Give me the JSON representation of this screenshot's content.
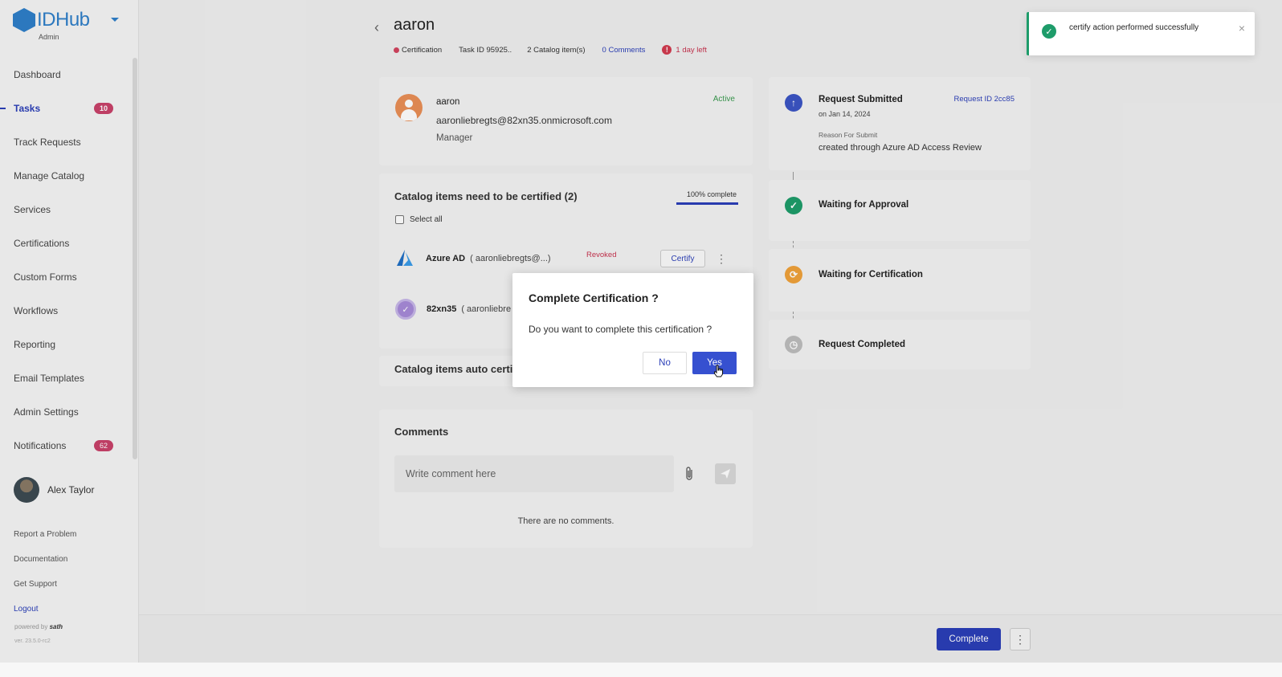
{
  "sidebar": {
    "brand": "IDHub",
    "brand_sub": "Admin",
    "items": [
      {
        "label": "Dashboard"
      },
      {
        "label": "Tasks",
        "badge": "10"
      },
      {
        "label": "Track Requests"
      },
      {
        "label": "Manage Catalog"
      },
      {
        "label": "Services"
      },
      {
        "label": "Certifications"
      },
      {
        "label": "Custom Forms"
      },
      {
        "label": "Workflows"
      },
      {
        "label": "Reporting"
      },
      {
        "label": "Email Templates"
      },
      {
        "label": "Admin Settings"
      },
      {
        "label": "Notifications",
        "badge": "62"
      }
    ],
    "user_name": "Alex Taylor",
    "links": [
      "Report a Problem",
      "Documentation",
      "Get Support",
      "Logout"
    ],
    "powered_by": "powered by",
    "powered_brand": "sath",
    "version": "ver. 23.5.0-rc2"
  },
  "header": {
    "title": "aaron",
    "type": "Certification",
    "task_id": "Task ID 95925..",
    "catalog_count": "2 Catalog item(s)",
    "comments": "0 Comments",
    "deadline": "1 day left"
  },
  "user_card": {
    "name": "aaron",
    "email": "aaronliebregts@82xn35.onmicrosoft.com",
    "role": "Manager",
    "status": "Active"
  },
  "catalog": {
    "title": "Catalog items need to be certified (2)",
    "progress_label": "100% complete",
    "progress": 1.0,
    "select_all": "Select all",
    "items": [
      {
        "name": "Azure AD",
        "account": "( aaronliebregts@...)",
        "status": "Revoked",
        "action": "Certify"
      },
      {
        "name": "82xn35",
        "account": "( aaronliebre"
      }
    ]
  },
  "auto_certified": {
    "title": "Catalog items auto certi"
  },
  "comments": {
    "title": "Comments",
    "placeholder": "Write comment here",
    "empty": "There are no comments."
  },
  "timeline": {
    "steps": [
      {
        "title": "Request Submitted",
        "request_id": "Request ID 2cc85",
        "date": "on Jan 14, 2024",
        "reason_label": "Reason For Submit",
        "reason": "created through Azure AD Access Review"
      },
      {
        "title": "Waiting for Approval"
      },
      {
        "title": "Waiting for Certification"
      },
      {
        "title": "Request Completed"
      }
    ]
  },
  "bottom": {
    "complete_label": "Complete"
  },
  "modal": {
    "title": "Complete Certification ?",
    "body": "Do you want to complete this certification ?",
    "no": "No",
    "yes": "Yes"
  },
  "toast": {
    "message": "certify action performed successfully"
  },
  "colors": {
    "accent": "#2b3fb8",
    "success": "#1e9c6a",
    "danger": "#c8334f",
    "warning": "#f0a23a"
  }
}
